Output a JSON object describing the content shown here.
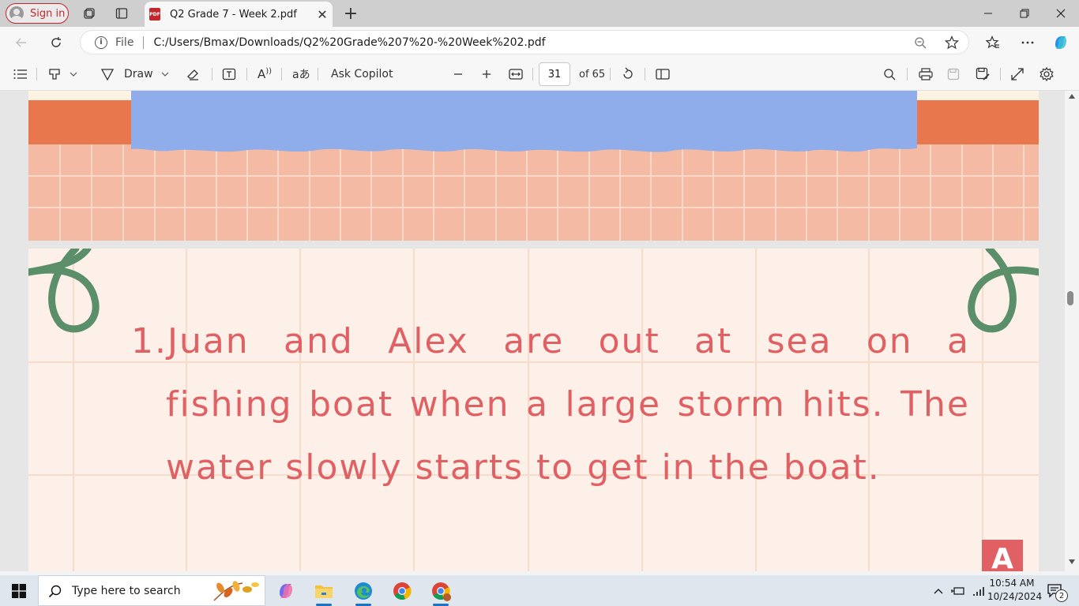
{
  "browser": {
    "signin_label": "Sign in",
    "tab_title": "Q2 Grade 7 - Week 2.pdf",
    "address_scheme_label": "File",
    "url": "C:/Users/Bmax/Downloads/Q2%20Grade%207%20-%20Week%202.pdf"
  },
  "pdf_toolbar": {
    "draw_label": "Draw",
    "ask_copilot_label": "Ask Copilot",
    "current_page": "31",
    "page_total_label": "of 65"
  },
  "document": {
    "question_line1": "1.Juan and Alex are out at sea on a",
    "question_line2": "fishing boat when a large storm hits. The water slowly starts to get in the boat.",
    "badge_letter": "A",
    "colors": {
      "question_text": "#e06063",
      "page_background": "#fdf0e8",
      "grid_orange": "#e8774d",
      "grid_peach": "#f5baa3",
      "blue_banner": "#8fadea",
      "curl_green": "#5a8f69"
    }
  },
  "taskbar": {
    "search_placeholder": "Type here to search",
    "time": "10:54 AM",
    "date": "10/24/2024",
    "notification_count": "2"
  }
}
